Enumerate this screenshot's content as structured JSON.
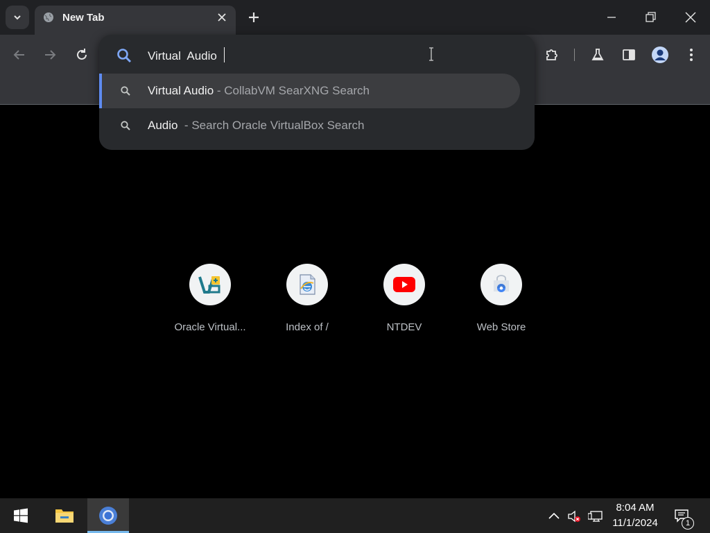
{
  "browser": {
    "tab": {
      "title": "New Tab",
      "favicon": "globe-icon"
    },
    "toolbar": {
      "icons": [
        "back-arrow-icon",
        "forward-arrow-icon",
        "reload-icon",
        "extensions-icon",
        "labs-flask-icon",
        "side-panel-icon",
        "profile-avatar-icon",
        "more-menu-icon"
      ]
    },
    "omnibox": {
      "input_value": "Virtual  Audio ",
      "suggestions": [
        {
          "main": "Virtual Audio",
          "sub": " - CollabVM SearXNG Search",
          "selected": true
        },
        {
          "main": "Audio",
          "sub": "  - Search Oracle VirtualBox Search",
          "selected": false
        }
      ]
    },
    "shortcuts": [
      {
        "label": "Oracle Virtual...",
        "icon": "virtualbox-icon"
      },
      {
        "label": "Index of /",
        "icon": "internet-explorer-icon"
      },
      {
        "label": "NTDEV",
        "icon": "youtube-icon"
      },
      {
        "label": "Web Store",
        "icon": "web-store-icon"
      }
    ]
  },
  "taskbar": {
    "apps": [
      "windows-start-icon",
      "file-explorer-icon",
      "chrome-icon"
    ],
    "tray": [
      "show-hidden-icons-chevron-icon",
      "volume-muted-icon",
      "network-icon",
      "notifications-icon"
    ],
    "time": "8:04 AM",
    "date": "11/1/2024",
    "notification_count": "1"
  },
  "colors": {
    "accent": "#5e8bf0",
    "page_background": "#000000",
    "toolbar": "#35363a",
    "youtube_red": "#ff0000"
  }
}
